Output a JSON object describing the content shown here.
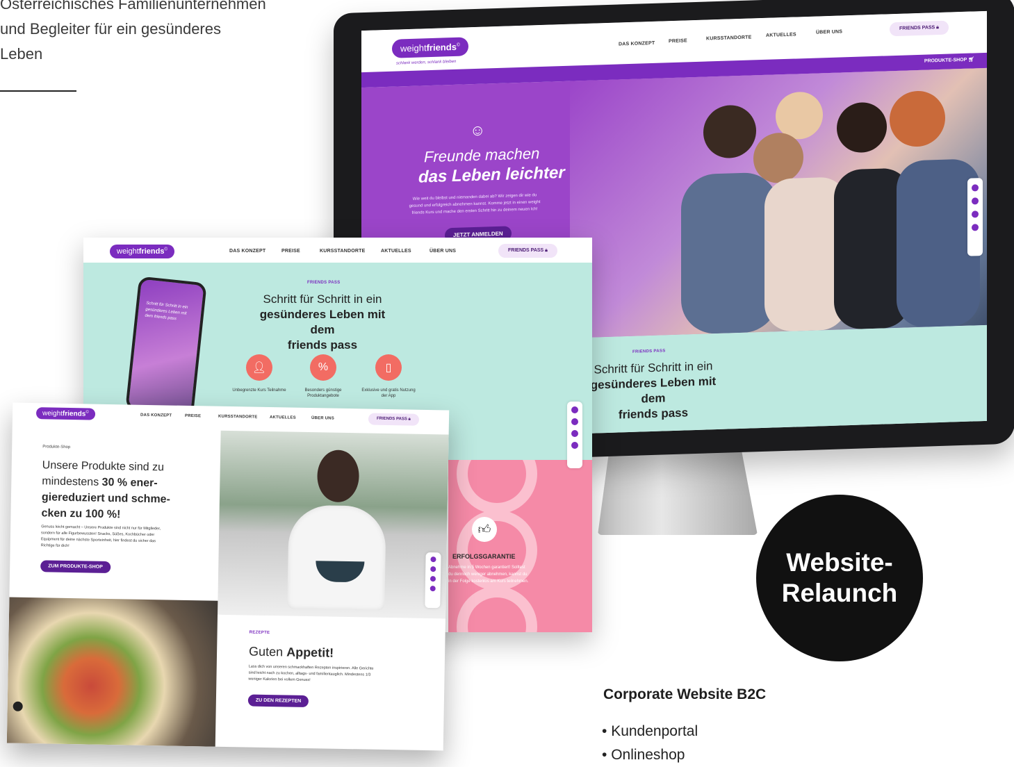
{
  "intro": {
    "line1": "Österreichisches Familienunternehmen",
    "line2": "und Begleiter für ein gesünderes",
    "line3": "Leben"
  },
  "brand": {
    "logo_light": "weight",
    "logo_bold": "friends",
    "logo_mark": "©",
    "tagline": "schlank werden, schlank bleiben",
    "primary_color": "#7b2cbf",
    "mint_color": "#bde9e0",
    "pink_color": "#f58aa7"
  },
  "monitor": {
    "nav": [
      "DAS KONZEPT",
      "PREISE",
      "KURSSTANDORTE",
      "AKTUELLES",
      "ÜBER UNS"
    ],
    "pass_button": "FRIENDS PASS",
    "shop_link": "PRODUKTE-SHOP",
    "hero": {
      "title_line1": "Freunde machen",
      "title_line2": "das Leben leichter",
      "text": "Wie weit du bleibst und niemanden dabei ab? Wir zeigen dir wie du gesund und erfolgreich abnehmen kannst. Komme jetzt in einen weight friends Kurs und mache den ersten Schritt hin zu deinem neuen Ich!",
      "cta": "JETZT ANMELDEN"
    },
    "friends_section": {
      "label": "FRIENDS PASS",
      "title_line1": "Schritt für Schritt in ein",
      "title_line2": "gesünderes Leben mit dem",
      "title_line3": "friends pass"
    }
  },
  "card_middle": {
    "nav": [
      "DAS KONZEPT",
      "PREISE",
      "KURSSTANDORTE",
      "AKTUELLES",
      "ÜBER UNS"
    ],
    "pass_button": "FRIENDS PASS",
    "label": "FRIENDS PASS",
    "title_line1": "Schritt für Schritt in ein",
    "title_line2": "gesünderes Leben mit dem",
    "title_line3": "friends pass",
    "phone_text": "Schritt für Schritt in ein gesünderes Leben mit dem friends pass",
    "features": [
      {
        "icon": "person-icon",
        "label": "Unbegrenzte Kurs Teilnahme"
      },
      {
        "icon": "percent-icon",
        "label": "Besonders günstige Produktangebote"
      },
      {
        "icon": "phone-icon",
        "label": "Exklusive und gratis Nutzung der App"
      }
    ],
    "guarantee": {
      "title": "ERFOLGSGARANTIE",
      "text": "Abnehme in 5 Wochen garantiert! Solltest du dennoch weniger abnehmen, kannst du in der Folge kostenlos am Kurs teilnehmen."
    }
  },
  "card_front": {
    "nav": [
      "DAS KONZEPT",
      "PREISE",
      "KURSSTANDORTE",
      "AKTUELLES",
      "ÜBER UNS"
    ],
    "pass_button": "FRIENDS PASS",
    "shop_label": "Produkte-Shop",
    "shop_title_1": "Unsere Produkte sind zu",
    "shop_title_2": "mindestens",
    "shop_title_bold": "30 % ener-",
    "shop_title_3": "giereduziert und schme-",
    "shop_title_4": "cken zu 100 %!",
    "shop_text": "Genuss leicht gemacht – Unsere Produkte sind nicht nur für Mitglieder, sondern für alle Figurbewussten! Snacks, Süßes, Kochbücher oder Equipment für deine nächste Sporteinheit, hier findest du sicher das Richtige für dich!",
    "shop_cta": "ZUM PRODUKTE-SHOP",
    "recipes_label": "REZEPTE",
    "recipes_title_light": "Guten",
    "recipes_title_bold": "Appetit!",
    "recipes_text": "Lass dich von unseren schmackhaften Rezepten inspirieren. Alle Gerichte sind leicht nach zu kochen, alltags- und familientauglich. Mindestens 1/3 weniger Kalorien bei vollem Genuss!",
    "recipes_cta": "ZU DEN REZEPTEN"
  },
  "badge": {
    "line1": "Website-",
    "line2": "Relaunch"
  },
  "corporate": {
    "title": "Corporate Website B2C",
    "bullets": [
      "Kundenportal",
      "Onlineshop"
    ]
  }
}
